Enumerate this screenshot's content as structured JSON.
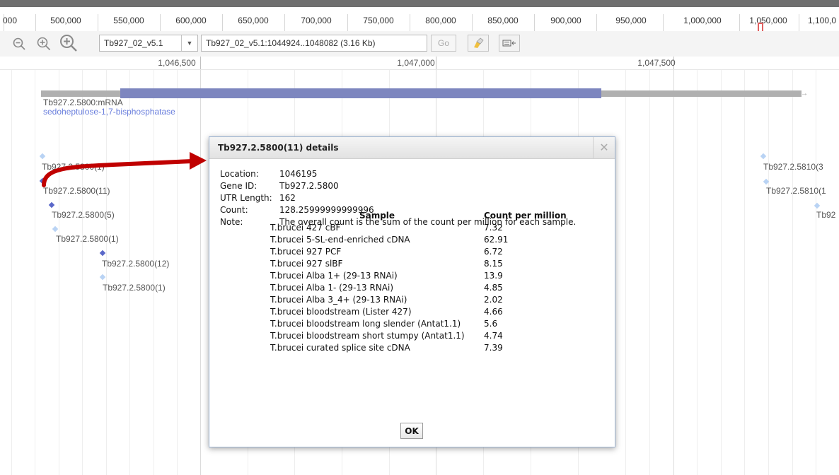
{
  "overview": {
    "labels": [
      "000",
      "500,000",
      "550,000",
      "600,000",
      "650,000",
      "700,000",
      "750,000",
      "800,000",
      "850,000",
      "900,000",
      "950,000",
      "1,000,000",
      "1,050,000",
      "1,100,0"
    ]
  },
  "toolbar": {
    "zoom_out_icon": "zoom-out-icon",
    "zoom_in_icon": "zoom-in-icon",
    "zoom_in_big_icon": "zoom-in-big-icon",
    "reference_sequence": "Tb927_02_v5.1",
    "location": "Tb927_02_v5.1:1044924..1048082 (3.16 Kb)",
    "go_label": "Go",
    "highlight_icon": "highlighter-icon",
    "track_icon": "track-toggle-icon"
  },
  "ruler": {
    "labels": [
      "1,046,500",
      "1,047,000",
      "1,047,500"
    ]
  },
  "tracks": {
    "mrna_name": "Tb927.2.5800:mRNA",
    "mrna_description": "sedoheptulose-1,7-bisphosphatase",
    "features": [
      "Tb927.2.5800(1)",
      "Tb927.2.5800(11)",
      "Tb927.2.5800(5)",
      "Tb927.2.5800(1)",
      "Tb927.2.5800(12)",
      "Tb927.2.5800(1)",
      "Tb927.2.5810(3",
      "Tb927.2.5810(1",
      "Tb92"
    ]
  },
  "dialog": {
    "title": "Tb927.2.5800(11) details",
    "close_icon": "close-icon",
    "fields": [
      {
        "key": "Location:",
        "value": "1046195"
      },
      {
        "key": "Gene ID:",
        "value": "Tb927.2.5800"
      },
      {
        "key": "UTR Length:",
        "value": "162"
      },
      {
        "key": "Count:",
        "value": "128.25999999999996"
      },
      {
        "key": "Note:",
        "value": "The overall count is the sum of the count per million for each sample."
      }
    ],
    "table_headers": [
      "Sample",
      "Count per million"
    ],
    "samples": [
      {
        "name": "T.brucei 427 cBF",
        "count": "7.32"
      },
      {
        "name": "T.brucei 5-SL-end-enriched cDNA",
        "count": "62.91"
      },
      {
        "name": "T.brucei 927 PCF",
        "count": "6.72"
      },
      {
        "name": "T.brucei 927 slBF",
        "count": "8.15"
      },
      {
        "name": "T.brucei Alba 1+ (29-13 RNAi)",
        "count": "13.9"
      },
      {
        "name": "T.brucei Alba 1- (29-13 RNAi)",
        "count": "4.85"
      },
      {
        "name": "T.brucei Alba 3_4+ (29-13 RNAi)",
        "count": "2.02"
      },
      {
        "name": "T.brucei bloodstream (Lister 427)",
        "count": "4.66"
      },
      {
        "name": "T.brucei bloodstream long slender (Antat1.1)",
        "count": "5.6"
      },
      {
        "name": "T.brucei bloodstream short stumpy (Antat1.1)",
        "count": "4.74"
      },
      {
        "name": "T.brucei curated splice site cDNA",
        "count": "7.39"
      }
    ],
    "ok_label": "OK"
  },
  "colors": {
    "cds": "#7d86bf",
    "utr": "#b0b0b0",
    "annotation_arrow": "#c00000",
    "feature_dark": "#5a68c9",
    "feature_light": "#b9d3f4"
  }
}
